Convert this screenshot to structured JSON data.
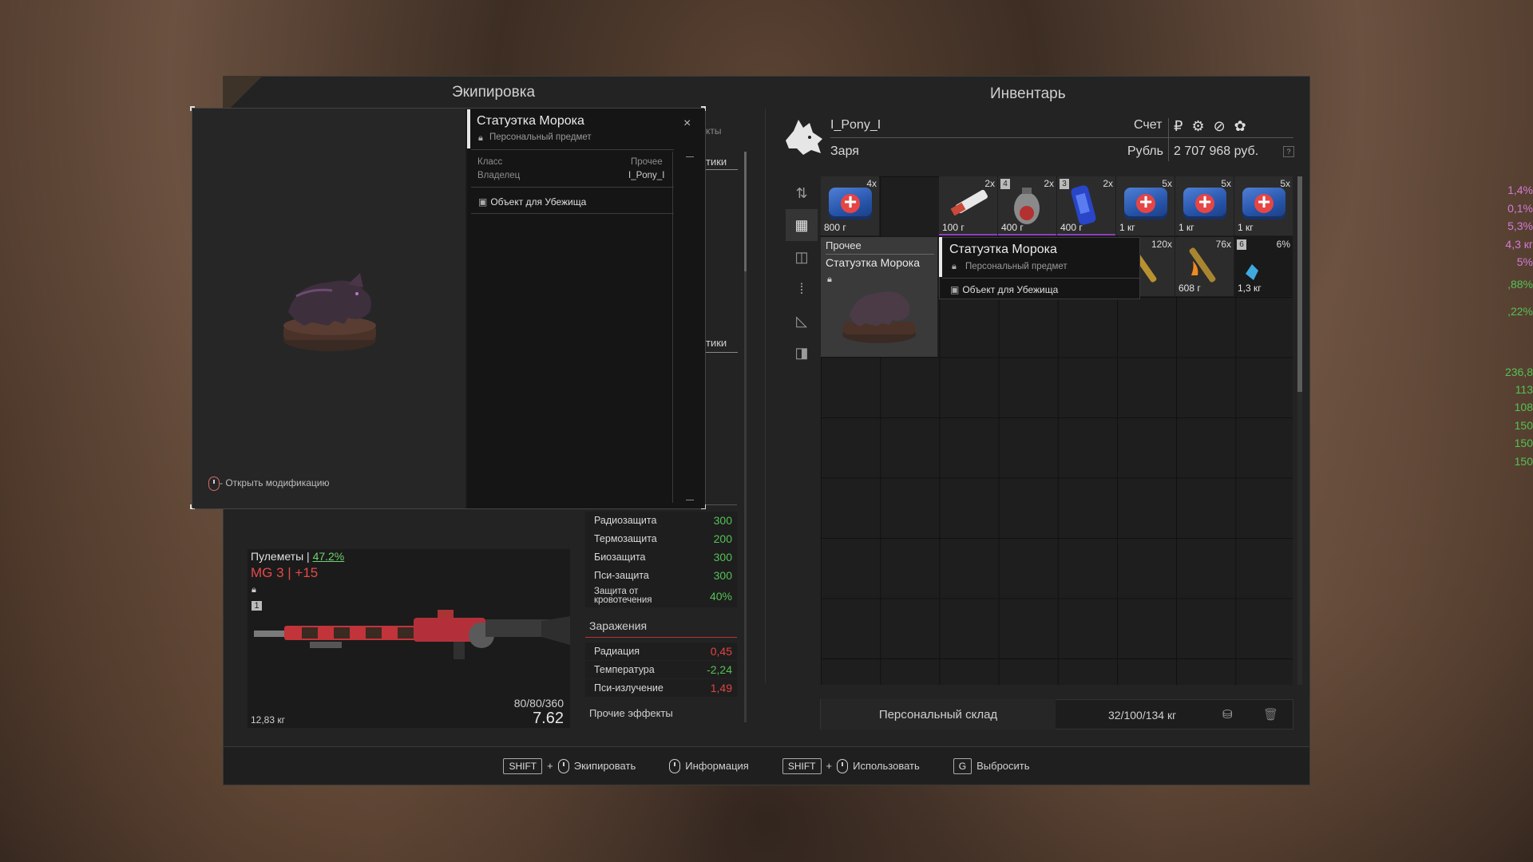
{
  "colors": {
    "accent_green": "#6fd16f",
    "accent_red": "#e04444",
    "value_green": "#55c155",
    "value_pink": "#d37bd6",
    "item_bar_purple": "#8a3cbf"
  },
  "equipment": {
    "title": "Экипировка",
    "weapon": {
      "category": "Пулеметы |",
      "category_pct": "47.2%",
      "name": "MG 3 | +15",
      "weight": "12,83 кг",
      "ammo": "80/80/360",
      "caliber": "7.62",
      "slot_number": "1"
    },
    "partial_tab": "кты",
    "partial_header_1": "тики",
    "partial_header_2": "тики",
    "partial_values_top": [
      "1,4%",
      "0,1%",
      "5,3%",
      "4,3 кг",
      "5%",
      ",88%",
      ",22%"
    ],
    "partial_values_mid": [
      "236,8",
      "113",
      "108",
      "150",
      "150",
      "150"
    ],
    "protection": [
      {
        "label": "Радиозащита",
        "value": "300"
      },
      {
        "label": "Термозащита",
        "value": "200"
      },
      {
        "label": "Биозащита",
        "value": "300"
      },
      {
        "label": "Пси-защита",
        "value": "300"
      },
      {
        "label": "Защита от кровотечения",
        "value": "40%"
      }
    ],
    "infections_title": "Заражения",
    "infections": [
      {
        "label": "Радиация",
        "value": "0,45"
      },
      {
        "label": "Температура",
        "value": "-2,24"
      },
      {
        "label": "Пси-излучение",
        "value": "1,49"
      }
    ],
    "other_effects": "Прочие эффекты"
  },
  "popup": {
    "title": "Статуэтка Морока",
    "subtitle": "Персональный предмет",
    "class_label": "Класс",
    "class_value": "Прочее",
    "owner_label": "Владелец",
    "owner_value": "I_Pony_I",
    "tag": "Объект для Убежища",
    "hint": "- Открыть модификацию",
    "close": "×"
  },
  "inventory": {
    "title": "Инвентарь",
    "player_name": "I_Pony_I",
    "faction": "Заря",
    "account_label": "Счет",
    "currency_label": "Рубль",
    "money": "2 707 968 руб.",
    "currency_icons": "₽ ⚙ ⊘ ✿",
    "help": "?",
    "tabs": [
      "sort-icon",
      "grid-icon",
      "camera-icon",
      "ammo-icon",
      "ruler-icon",
      "split-icon"
    ],
    "items_row1": [
      {
        "count": "4x",
        "weight": "800 г",
        "type": "medkit"
      },
      {
        "count": "2x",
        "weight": "100 г",
        "type": "syringe"
      },
      {
        "count": "2x",
        "weight": "400 г",
        "type": "grenade",
        "num": "4"
      },
      {
        "count": "2x",
        "weight": "400 г",
        "type": "energy",
        "num": "3"
      },
      {
        "count": "5x",
        "weight": "1 кг",
        "type": "medkit"
      },
      {
        "count": "5x",
        "weight": "1 кг",
        "type": "medkit"
      },
      {
        "count": "5x",
        "weight": "1 кг",
        "type": "medkit"
      }
    ],
    "items_row2": [
      {
        "count": "120x",
        "weight": "г"
      },
      {
        "count": "76x",
        "weight": "608 г"
      },
      {
        "count": "6%",
        "weight": "1,3 кг",
        "num": "6"
      }
    ],
    "big_item": {
      "label": "Прочее",
      "name": "Статуэтка Морока"
    },
    "tooltip": {
      "title": "Статуэтка Морока",
      "subtitle": "Персональный предмет",
      "tag": "Объект для Убежища"
    },
    "stash_label": "Персональный склад",
    "stash_weight": "32/100/134 кг"
  },
  "bottom_bar": {
    "equip_key": "SHIFT",
    "equip_label": "Экипировать",
    "info_label": "Информация",
    "use_key": "SHIFT",
    "use_label": "Использовать",
    "drop_key": "G",
    "drop_label": "Выбросить",
    "plus": "+"
  }
}
